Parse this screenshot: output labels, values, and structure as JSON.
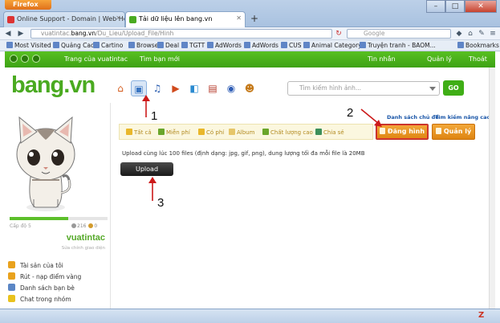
{
  "browser": {
    "menu_button": "Firefox",
    "tabs": [
      {
        "label": "Online Support - Domain | Web Hosti...",
        "active": false
      },
      {
        "label": "Tải dữ liệu lên bang.vn",
        "active": true
      }
    ],
    "new_tab": "+",
    "url_prefix": "vuatintac.",
    "url_domain": "bang.vn",
    "url_path": "/Du_Lieu/Upload_File/Hinh",
    "search_placeholder": "Google",
    "bookmarks": [
      "Most Visited",
      "Quảng Cao",
      "Cartino",
      "Browse",
      "Deal",
      "TGTT",
      "AdWords",
      "AdWords",
      "CUS",
      "Animal Category",
      "Truyện tranh - BAOM...",
      "Bookmarks"
    ]
  },
  "site_topbar": {
    "home_link": "Trang của vuatintac",
    "friends_link": "Tìm bạn mới",
    "messages": "Tin nhắn",
    "manage": "Quản lý",
    "logout": "Thoát"
  },
  "header": {
    "logo": "bang",
    "logo_suffix": ".vn",
    "search_placeholder": "Tìm kiếm hình ảnh...",
    "go_label": "GO"
  },
  "profile": {
    "level": "Cấp độ 5",
    "points": "216",
    "coins": "0",
    "username": "vuatintac",
    "edit_link": "Sửa chính giao diện",
    "level_progress": 0.6
  },
  "sidebar_menu": [
    {
      "label": "Tài sản của tôi",
      "color": "#e9a21d"
    },
    {
      "label": "Rút - nạp điểm vàng",
      "color": "#e9a21d"
    },
    {
      "label": "Danh sách bạn bè",
      "color": "#5b86c5"
    },
    {
      "label": "Chat trong nhóm",
      "color": "#e9c21d"
    }
  ],
  "main": {
    "top_links": [
      "Danh sách chủ đề",
      "Tìm kiếm nâng cao"
    ],
    "filters": [
      "Tất cả",
      "Miễn phí",
      "Có phí",
      "Album",
      "Chất lượng cao",
      "Chia sẻ"
    ],
    "buttons": {
      "upload_image": "Đăng hình",
      "manage": "Quản lý"
    },
    "upload_note": "Upload cùng lúc 100 files (định dạng: jpg, gif, png), dung lượng tối đa mỗi file là 20MB",
    "upload_button": "Upload"
  },
  "annotations": [
    "1",
    "2",
    "3"
  ],
  "colors": {
    "brand_green": "#4aaa20",
    "topbar_green": "#49b11a",
    "orange": "#e8901f",
    "annotation_red": "#cc1a1a"
  }
}
